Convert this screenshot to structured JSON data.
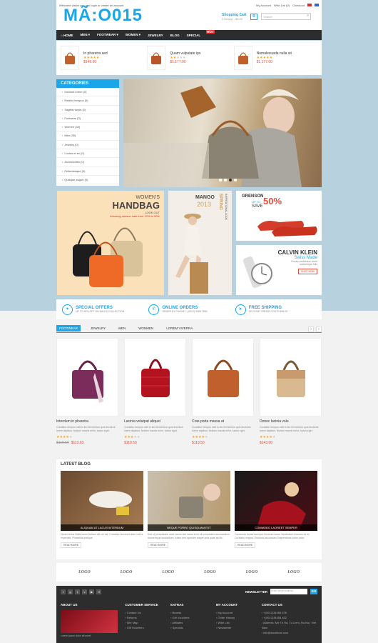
{
  "topbar": {
    "welcome": "Welcome visitor you can login or create an account",
    "my_account": "My Account",
    "wishlist": "Wish List (0)",
    "checkout": "Checkout"
  },
  "header": {
    "logo": "MÃ:O015",
    "cart_title": "Shopping Cart",
    "cart_sub": "0 item(s) - $0.00",
    "search_placeholder": "Search"
  },
  "nav": [
    "HOME",
    "MEN",
    "FOOTWEAR",
    "WOMEN",
    "JEWELRY",
    "BLOG",
    "SPECIAL"
  ],
  "nav_badge": "HOT",
  "strip": [
    {
      "name": "In pharetra sed",
      "price": "$149.00"
    },
    {
      "name": "Quam vulputate ips",
      "price": "$1,177.00"
    },
    {
      "name": "Numalesuada nulla sit",
      "price": "$1,177.00"
    }
  ],
  "categories": {
    "title": "CATEGORIES",
    "items": [
      "Incidunt lorem (0)",
      "Rabitur tempus (0)",
      "Sagittis turpis (0)",
      "Footwear (0)",
      "Women (34)",
      "Men (30)",
      "Jewelry (0)",
      "Luctus et ex (0)",
      "Accessories (0)",
      "Pellentesque (0)",
      "Quisque augue (0)"
    ]
  },
  "banners": {
    "handbag_1": "WOMEN'S",
    "handbag_2": "HANDBAG",
    "handbag_3": "LOOK OUT",
    "handbag_4": "Amazing season sale from 10% to 50%",
    "mango_1": "MANGO",
    "mango_2": "2013",
    "mango_3": "SPRING",
    "mango_4": "INSPIRATIONAL LOOK",
    "grenson_1": "GRENSON",
    "grenson_2": "UP TO",
    "grenson_3": "50%",
    "grenson_4": "SAVE",
    "ck_1": "CALVIN KLEIN",
    "ck_2": "Swiss Made",
    "ck_3": "Donec vestibulum amet scelerisque felis",
    "ck_btn": "SHOP NOW"
  },
  "features": [
    {
      "title": "SPECIAL OFFERS",
      "sub": "UP TO 50% OFF ON SALES COLLECTION"
    },
    {
      "title": "ONLINE ORDERS",
      "sub": "ORDER BY PHONE + (0012) 3456 7890"
    },
    {
      "title": "FREE SHIPPING",
      "sub": "ON YOUR ORDER COSTS $99.00"
    }
  ],
  "tabs": [
    "FOOTWEAR",
    "JEWELRY",
    "MEN",
    "WONMEN",
    "LOREM VIVERRA"
  ],
  "products": [
    {
      "name": "Interdum in pharetra",
      "desc": "Curabitur tempus velit in leo fermentum quis tincidunt lorem dapibus. Nullam mauris enim, luctus eget.",
      "old": "$119.50",
      "price": "$113.63"
    },
    {
      "name": "Lacinia volutpat aliquet",
      "desc": "Curabitur tempus velit in leo fermentum quis tincidunt lorem dapibus. Nullam mauris enim, luctus eget.",
      "old": "",
      "price": "$119.50"
    },
    {
      "name": "Cras porta massa at",
      "desc": "Curabitur tempus velit in leo fermentum quis tincidunt lorem dapibus. Nullam mauris enim, luctus eget.",
      "old": "",
      "price": "$119.50"
    },
    {
      "name": "Donec lacinia volu",
      "desc": "Curabitur tempus velit in leo fermentum quis tincidunt lorem dapibus. Nullam mauris enim, luctus eget.",
      "old": "",
      "price": "$143.00"
    }
  ],
  "blog": {
    "title": "LATEST BLOG",
    "read_more": "READ MORE",
    "posts": [
      {
        "cap": "ALIQUAM AT LACUS INTERDUM",
        "text": "Donec tellus Nulla lorem Nullam elit vel est. Curabitur tincidunt diam velit a imperdiet. Phasellus tristique."
      },
      {
        "cap": "NEQUE PORRO QUISQUAM EST",
        "text": "Sed ut perspiciatis unde omnis iste natus error sit voluptatem accusantium doloremque laudantium, totam rem aperiam eaque ipsa quae ab illo."
      },
      {
        "cap": "COMMODO LAOREET SEMPER",
        "text": "Commodo laoreet semper tincidunt lorem Vestibulum rhoncus ac ex Curabitur magna. Euismod accumsan Suspendisse tortor dolor."
      }
    ]
  },
  "brand_logos": [
    "LOGO",
    "LOGO",
    "LOGO",
    "LOGO",
    "LOGO",
    "LOGO"
  ],
  "newsletter": {
    "label": "NEWSLETTER",
    "placeholder": "Enter email address",
    "btn": "GO"
  },
  "footer": [
    {
      "title": "ABOUT US",
      "items": [
        "Lorem ipsum dolor sit amet"
      ]
    },
    {
      "title": "CUSTOMER SERVICE",
      "items": [
        "Contact Us",
        "Returns",
        "Site Map",
        "Gift Vouchers"
      ]
    },
    {
      "title": "EXTRAS",
      "items": [
        "Brands",
        "Gift Vouchers",
        "Affiliates",
        "Specials"
      ]
    },
    {
      "title": "MY ACCOUNT",
      "items": [
        "My Account",
        "Order History",
        "Wish List",
        "Newsletter"
      ]
    },
    {
      "title": "CONTACT US",
      "items": [
        "+(0012)34456 676",
        "+(0012)34456 452",
        "Address: Me Tri Ha, Tu Liem, Ha Noi, Viet Nam",
        "info@localhost.com"
      ]
    }
  ]
}
